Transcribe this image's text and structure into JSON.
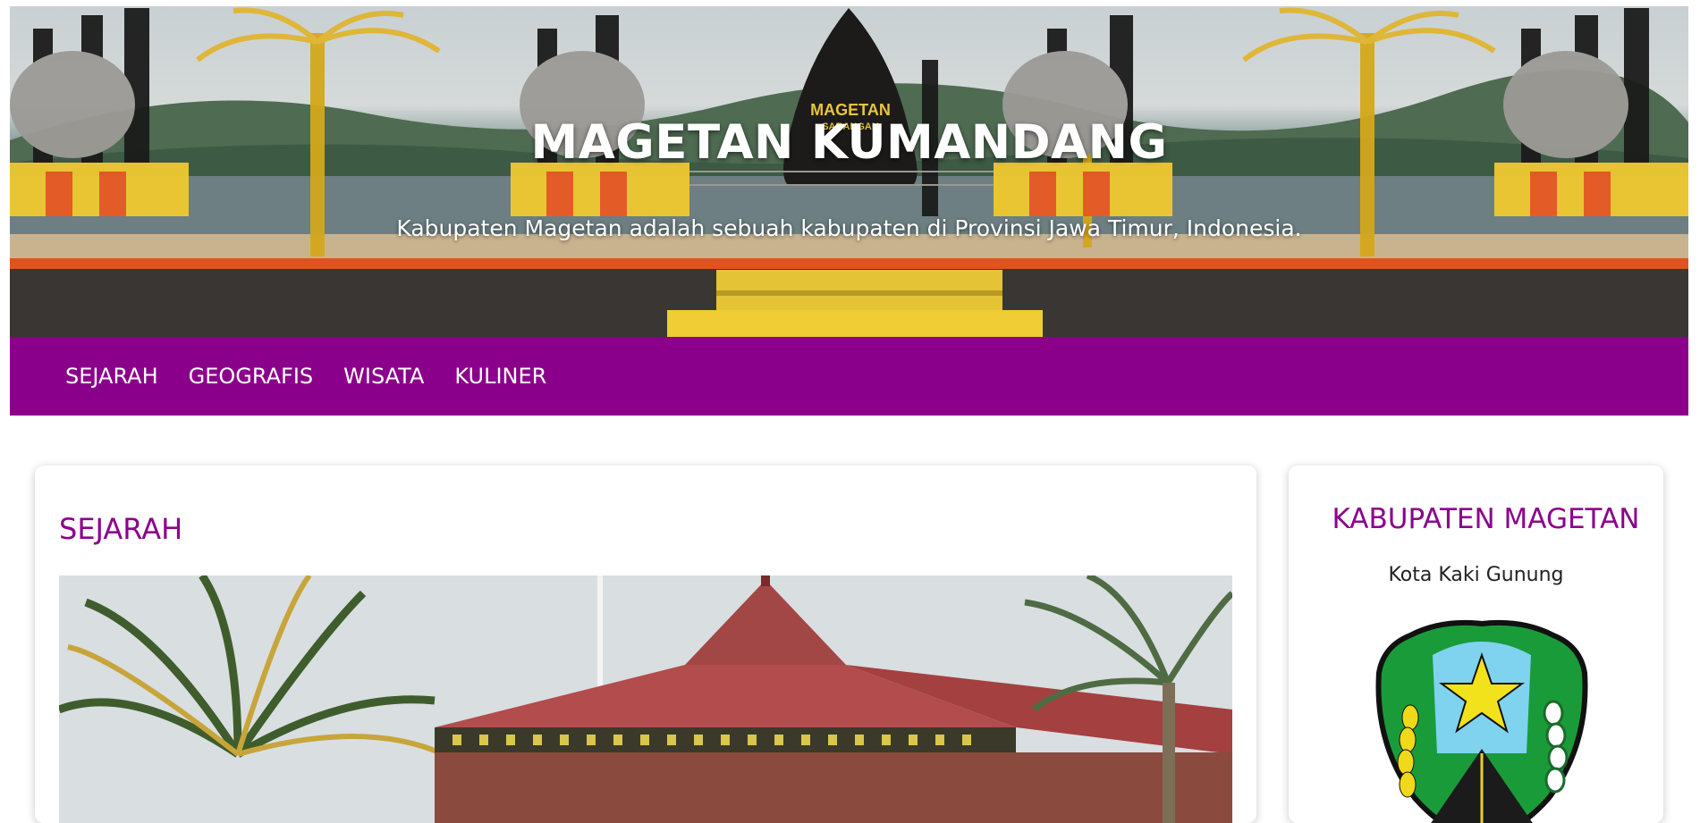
{
  "header": {
    "title": "MAGETAN KUMANDANG",
    "subtitle": "Kabupaten Magetan adalah sebuah kabupaten di Provinsi Jawa Timur, Indonesia.",
    "banner_sign_text": "MAGETAN",
    "banner_sign_subtext": "SARANGAN"
  },
  "nav": {
    "items": [
      {
        "label": "SEJARAH"
      },
      {
        "label": "GEOGRAFIS"
      },
      {
        "label": "WISATA"
      },
      {
        "label": "KULINER"
      }
    ]
  },
  "main": {
    "section_title": "SEJARAH"
  },
  "sidebar": {
    "title": "KABUPATEN MAGETAN",
    "subtitle": "Kota Kaki Gunung"
  },
  "colors": {
    "accent": "#8b008b",
    "nav_text": "#ffffff"
  }
}
